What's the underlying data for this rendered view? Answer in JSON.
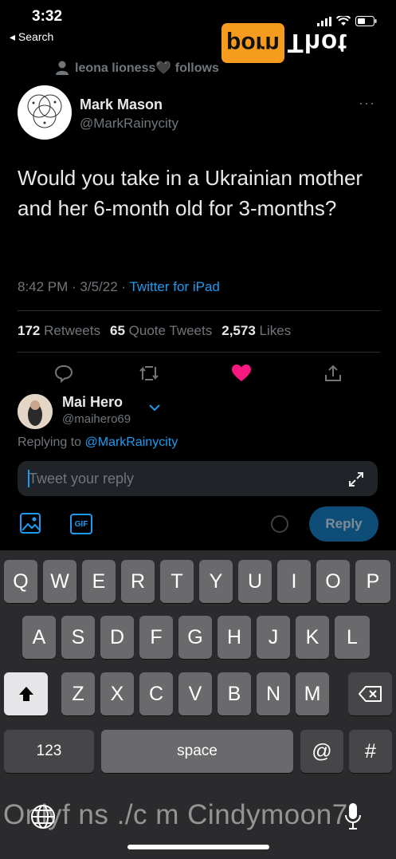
{
  "status_bar": {
    "time": "3:32",
    "back_label": "◂ Search"
  },
  "watermark": {
    "left": "Thot",
    "right": "porn"
  },
  "social_context": {
    "text": "leona lioness🖤 follows"
  },
  "tweet": {
    "author_name": "Mark Mason",
    "author_handle": "@MarkRainycity",
    "more": "···",
    "text": "Would you take in a Ukrainian mother and her 6-month old for 3-months?",
    "time": "8:42 PM · 3/5/22 · ",
    "source": "Twitter for iPad",
    "stats": {
      "retweets_count": "172",
      "retweets_label": "Retweets",
      "quotes_count": "65",
      "quotes_label": "Quote Tweets",
      "likes_count": "2,573",
      "likes_label": "Likes"
    },
    "liked": true
  },
  "reply": {
    "name": "Mai Hero",
    "handle": "@maihero69",
    "replying_prefix": "Replying to ",
    "replying_to": "@MarkRainycity",
    "placeholder": "Tweet your reply",
    "gif_label": "GIF",
    "button_label": "Reply"
  },
  "keyboard": {
    "row1": [
      "Q",
      "W",
      "E",
      "R",
      "T",
      "Y",
      "U",
      "I",
      "O",
      "P"
    ],
    "row2": [
      "A",
      "S",
      "D",
      "F",
      "G",
      "H",
      "J",
      "K",
      "L"
    ],
    "row3": [
      "Z",
      "X",
      "C",
      "V",
      "B",
      "N",
      "M"
    ],
    "numbers_label": "123",
    "space_label": "space",
    "at_label": "@",
    "hash_label": "#"
  },
  "overlay": {
    "text": "Onlyf ns ./c m Cindymoon7"
  },
  "colors": {
    "accent": "#1d9bf0",
    "like": "#f91880",
    "badge": "#f59b1e"
  }
}
